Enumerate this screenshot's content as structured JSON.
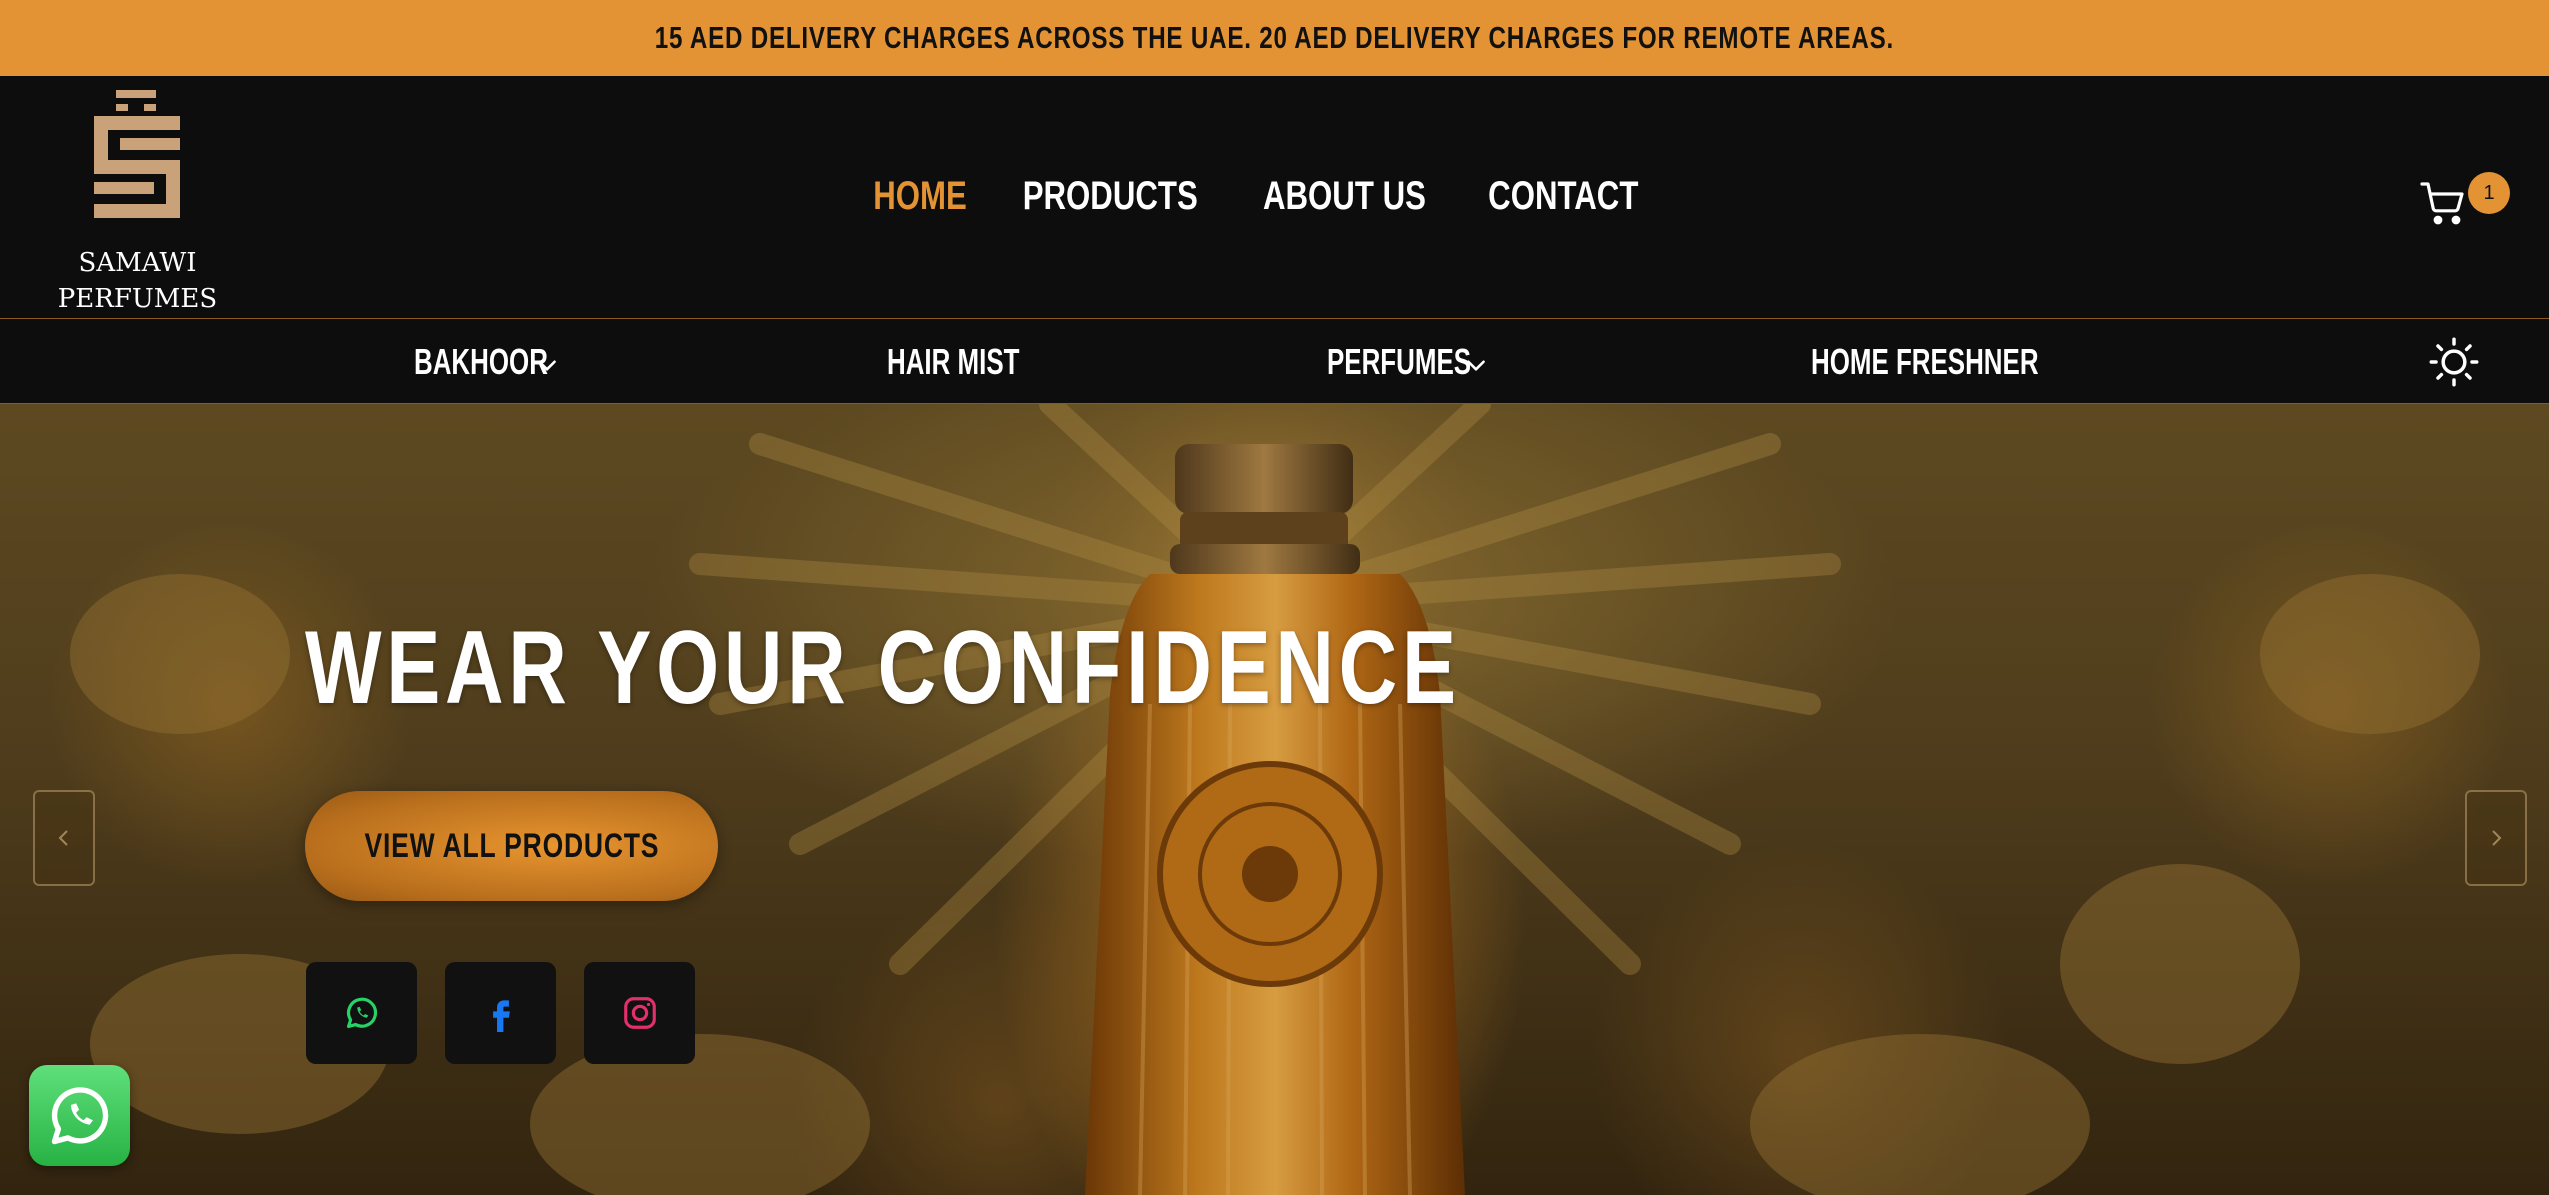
{
  "announcement": {
    "text": "15 AED DELIVERY CHARGES ACROSS THE UAE. 20 AED DELIVERY CHARGES FOR REMOTE AREAS."
  },
  "brand": {
    "line1": "SAMAWI",
    "line2": "PERFUMES",
    "logo_icon": "perfume-bottle-logo-icon"
  },
  "nav": {
    "items": [
      {
        "label": "HOME",
        "active": true
      },
      {
        "label": "PRODUCTS",
        "active": false
      },
      {
        "label": "ABOUT US",
        "active": false
      },
      {
        "label": "CONTACT",
        "active": false
      }
    ]
  },
  "cart": {
    "icon": "cart-icon",
    "count": "1"
  },
  "categories": [
    {
      "label": "BAKHOOR",
      "dropdown": true
    },
    {
      "label": "HAIR MIST",
      "dropdown": false
    },
    {
      "label": "PERFUMES",
      "dropdown": true
    },
    {
      "label": "HOME FRESHNER",
      "dropdown": false
    }
  ],
  "theme_toggle": {
    "icon": "sun-icon"
  },
  "hero": {
    "title": "WEAR YOUR CONFIDENCE",
    "cta_label": "VIEW ALL PRODUCTS",
    "social": [
      {
        "name": "whatsapp",
        "icon": "whatsapp-icon",
        "color": "#25d366"
      },
      {
        "name": "facebook",
        "icon": "facebook-icon",
        "color": "#1877f2"
      },
      {
        "name": "instagram",
        "icon": "instagram-icon",
        "color": "#e1306c"
      }
    ],
    "prev_icon": "chevron-left-icon",
    "next_icon": "chevron-right-icon"
  },
  "floating_whatsapp": {
    "icon": "whatsapp-icon"
  },
  "colors": {
    "accent": "#e39333",
    "background": "#0d0d0d",
    "text": "#ffffff"
  }
}
